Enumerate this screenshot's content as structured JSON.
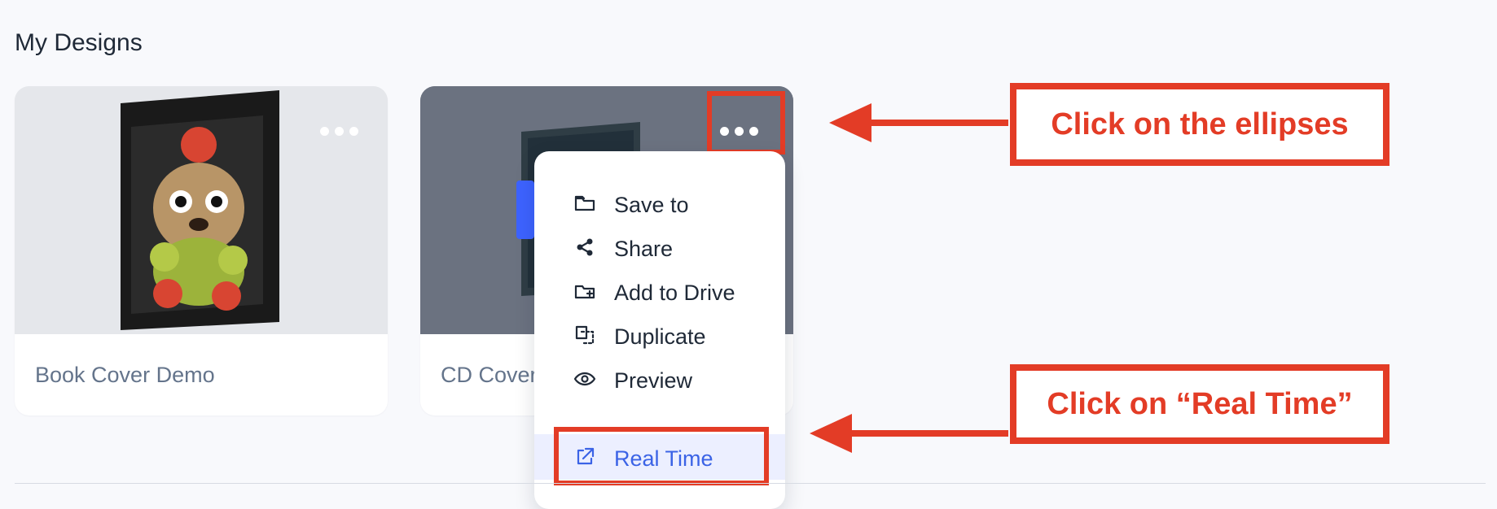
{
  "section_title": "My Designs",
  "cards": [
    {
      "label": "Book Cover Demo",
      "thumbnail_icon": "book-cover-thumbnail"
    },
    {
      "label": "CD Cover",
      "thumbnail_icon": "cd-cover-thumbnail"
    }
  ],
  "menu": {
    "items": [
      {
        "label": "Save to",
        "icon": "folder-icon"
      },
      {
        "label": "Share",
        "icon": "share-icon"
      },
      {
        "label": "Add to Drive",
        "icon": "add-folder-icon"
      },
      {
        "label": "Duplicate",
        "icon": "duplicate-icon"
      },
      {
        "label": "Preview",
        "icon": "eye-icon"
      },
      {
        "label": "Real Time",
        "icon": "external-link-icon",
        "active": true
      }
    ]
  },
  "annotations": {
    "ellipses": "Click on the ellipses",
    "real_time": "Click on “Real Time”"
  },
  "colors": {
    "annotation_red": "#e33c26",
    "active_item_blue": "#3b63e6",
    "active_item_bg": "#ecefff",
    "card_label_gray": "#64748b"
  }
}
